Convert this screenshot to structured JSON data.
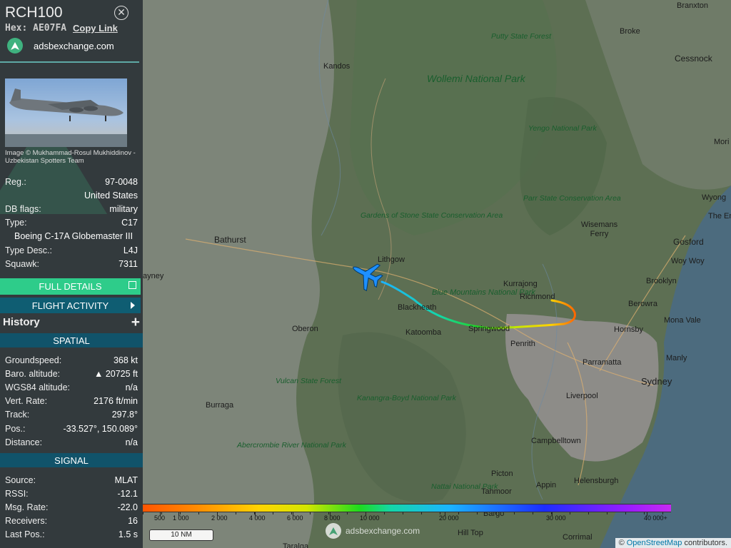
{
  "aircraft": {
    "callsign": "RCH100",
    "hex_label": "Hex:",
    "hex_value": "AE07FA",
    "copy_link": "Copy Link",
    "site": "adsbexchange.com",
    "photo_credit": "Image © Mukhammad-Rosul Mukhiddinov - Uzbekistan Spotters Team"
  },
  "details": {
    "reg_key": "Reg.:",
    "reg_value": "97-0048",
    "country": "United States",
    "dbflags_key": "DB flags:",
    "dbflags_value": "military",
    "type_key": "Type:",
    "type_value": "C17",
    "type_full": "Boeing C-17A Globemaster III",
    "typedesc_key": "Type Desc.:",
    "typedesc_value": "L4J",
    "squawk_key": "Squawk:",
    "squawk_value": "7311"
  },
  "buttons": {
    "full_details": "FULL DETAILS",
    "flight_activity": "FLIGHT ACTIVITY",
    "history": "History",
    "plus": "+"
  },
  "spatial": {
    "header": "SPATIAL",
    "groundspeed_key": "Groundspeed:",
    "groundspeed_value": "368 kt",
    "baro_key": "Baro. altitude:",
    "baro_value": "▲ 20725 ft",
    "wgs_key": "WGS84 altitude:",
    "wgs_value": "n/a",
    "vert_key": "Vert. Rate:",
    "vert_value": "2176 ft/min",
    "track_key": "Track:",
    "track_value": "297.8°",
    "pos_key": "Pos.:",
    "pos_value": "-33.527°, 150.089°",
    "distance_key": "Distance:",
    "distance_value": "n/a"
  },
  "signal": {
    "header": "SIGNAL",
    "source_key": "Source:",
    "source_value": "MLAT",
    "rssi_key": "RSSI:",
    "rssi_value": "-12.1",
    "msg_key": "Msg. Rate:",
    "msg_value": "-22.0",
    "receivers_key": "Receivers:",
    "receivers_value": "16",
    "lastpos_key": "Last Pos.:",
    "lastpos_value": "1.5 s"
  },
  "map": {
    "labels": {
      "branxton": "Branxton",
      "broke": "Broke",
      "cessnock": "Cessnock",
      "putty": "Putty State Forest",
      "kandos": "Kandos",
      "wollemi": "Wollemi National Park",
      "yengo": "Yengo National Park",
      "mori": "Mori",
      "wyong": "Wyong",
      "theen": "The En",
      "parr": "Parr State Conservation Area",
      "wisemans": "Wisemans Ferry",
      "gosford": "Gosford",
      "woywoy": "Woy Woy",
      "gardens": "Gardens of Stone State Conservation Area",
      "bathurst": "Bathurst",
      "lithgow": "Lithgow",
      "ayney": "ayney",
      "kurrajong": "Kurrajong",
      "richmond": "Richmond",
      "brooklyn": "Brooklyn",
      "berowra": "Berowra",
      "blackheath": "Blackheath",
      "bluemountains": "Blue Mountains National Park",
      "monavale": "Mona Vale",
      "hornsby": "Hornsby",
      "oberon": "Oberon",
      "katoomba": "Katoomba",
      "springwood": "Springwood",
      "penrith": "Penrith",
      "manly": "Manly",
      "parramatta": "Parramatta",
      "sydney": "Sydney",
      "vulcan": "Vulcan State Forest",
      "burraga": "Burraga",
      "liverpool": "Liverpool",
      "kanangra": "Kanangra-Boyd National Park",
      "abercrombie": "Abercrombie River National Park",
      "campbelltown": "Campbelltown",
      "picton": "Picton",
      "appin": "Appin",
      "helensburgh": "Helensburgh",
      "tahmoor": "Tahmoor",
      "nattai": "Nattai National Park",
      "bargo": "Bargo",
      "hilltop": "Hill Top",
      "corrimal": "Corrimal",
      "taralga": "Taralga"
    },
    "altitude_scale": [
      "500",
      "1 000",
      "2 000",
      "4 000",
      "6 000",
      "8 000",
      "10 000",
      "20 000",
      "30 000",
      "40 000+"
    ],
    "scale_bar": "10 NM",
    "watermark": "adsbexchange.com",
    "attribution_prefix": "©",
    "attribution_link": "OpenStreetMap",
    "attribution_suffix": "contributors."
  },
  "colors": {
    "sidebar": "#333a3d",
    "accent_green": "#2ecc8a",
    "section_teal": "#11536a",
    "aircraft_icon": "#1e90ff"
  }
}
